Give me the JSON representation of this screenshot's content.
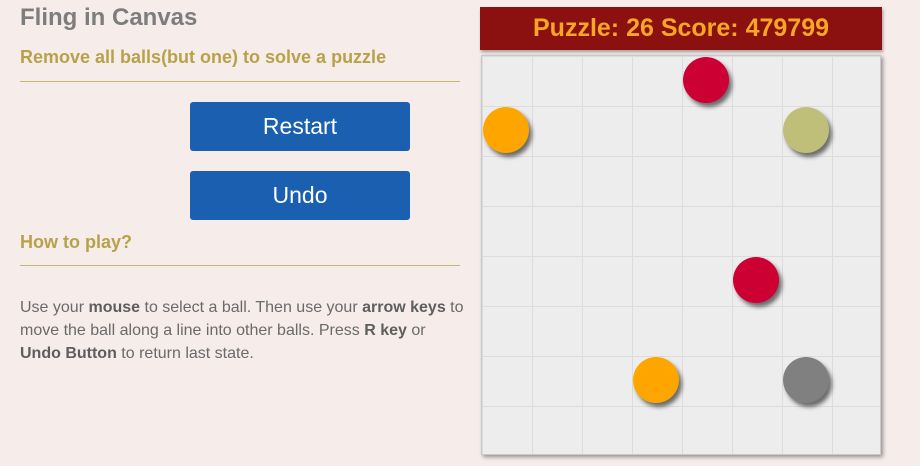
{
  "app": {
    "title": "Fling in Canvas",
    "subtitle": "Remove all balls(but one) to solve a puzzle"
  },
  "buttons": {
    "restart": "Restart",
    "undo": "Undo"
  },
  "how_to": {
    "heading": "How to play?",
    "t1": "Use your ",
    "k1": "mouse",
    "t2": " to select a ball. Then use your ",
    "k2": "arrow keys",
    "t3": " to move the ball along a line into other balls. Press ",
    "k3": "R key",
    "t4": " or ",
    "k4": "Undo Button",
    "t5": " to return last state."
  },
  "game": {
    "header": "Puzzle: 26 Score: 479799",
    "puzzle": 26,
    "score": 479799,
    "grid": {
      "cols": 8,
      "rows": 8
    },
    "balls": [
      {
        "color": "#cc0033",
        "col": 4,
        "row": 0
      },
      {
        "color": "#ffa500",
        "col": 0,
        "row": 1
      },
      {
        "color": "#bfbf7a",
        "col": 6,
        "row": 1
      },
      {
        "color": "#cc0033",
        "col": 5,
        "row": 4
      },
      {
        "color": "#ffa500",
        "col": 3,
        "row": 6
      },
      {
        "color": "#808080",
        "col": 6,
        "row": 6
      }
    ]
  },
  "colors": {
    "header_bg": "#8b1111",
    "header_text": "#f5a623",
    "button_bg": "#1a5fb0",
    "accent": "#b7a24a"
  }
}
